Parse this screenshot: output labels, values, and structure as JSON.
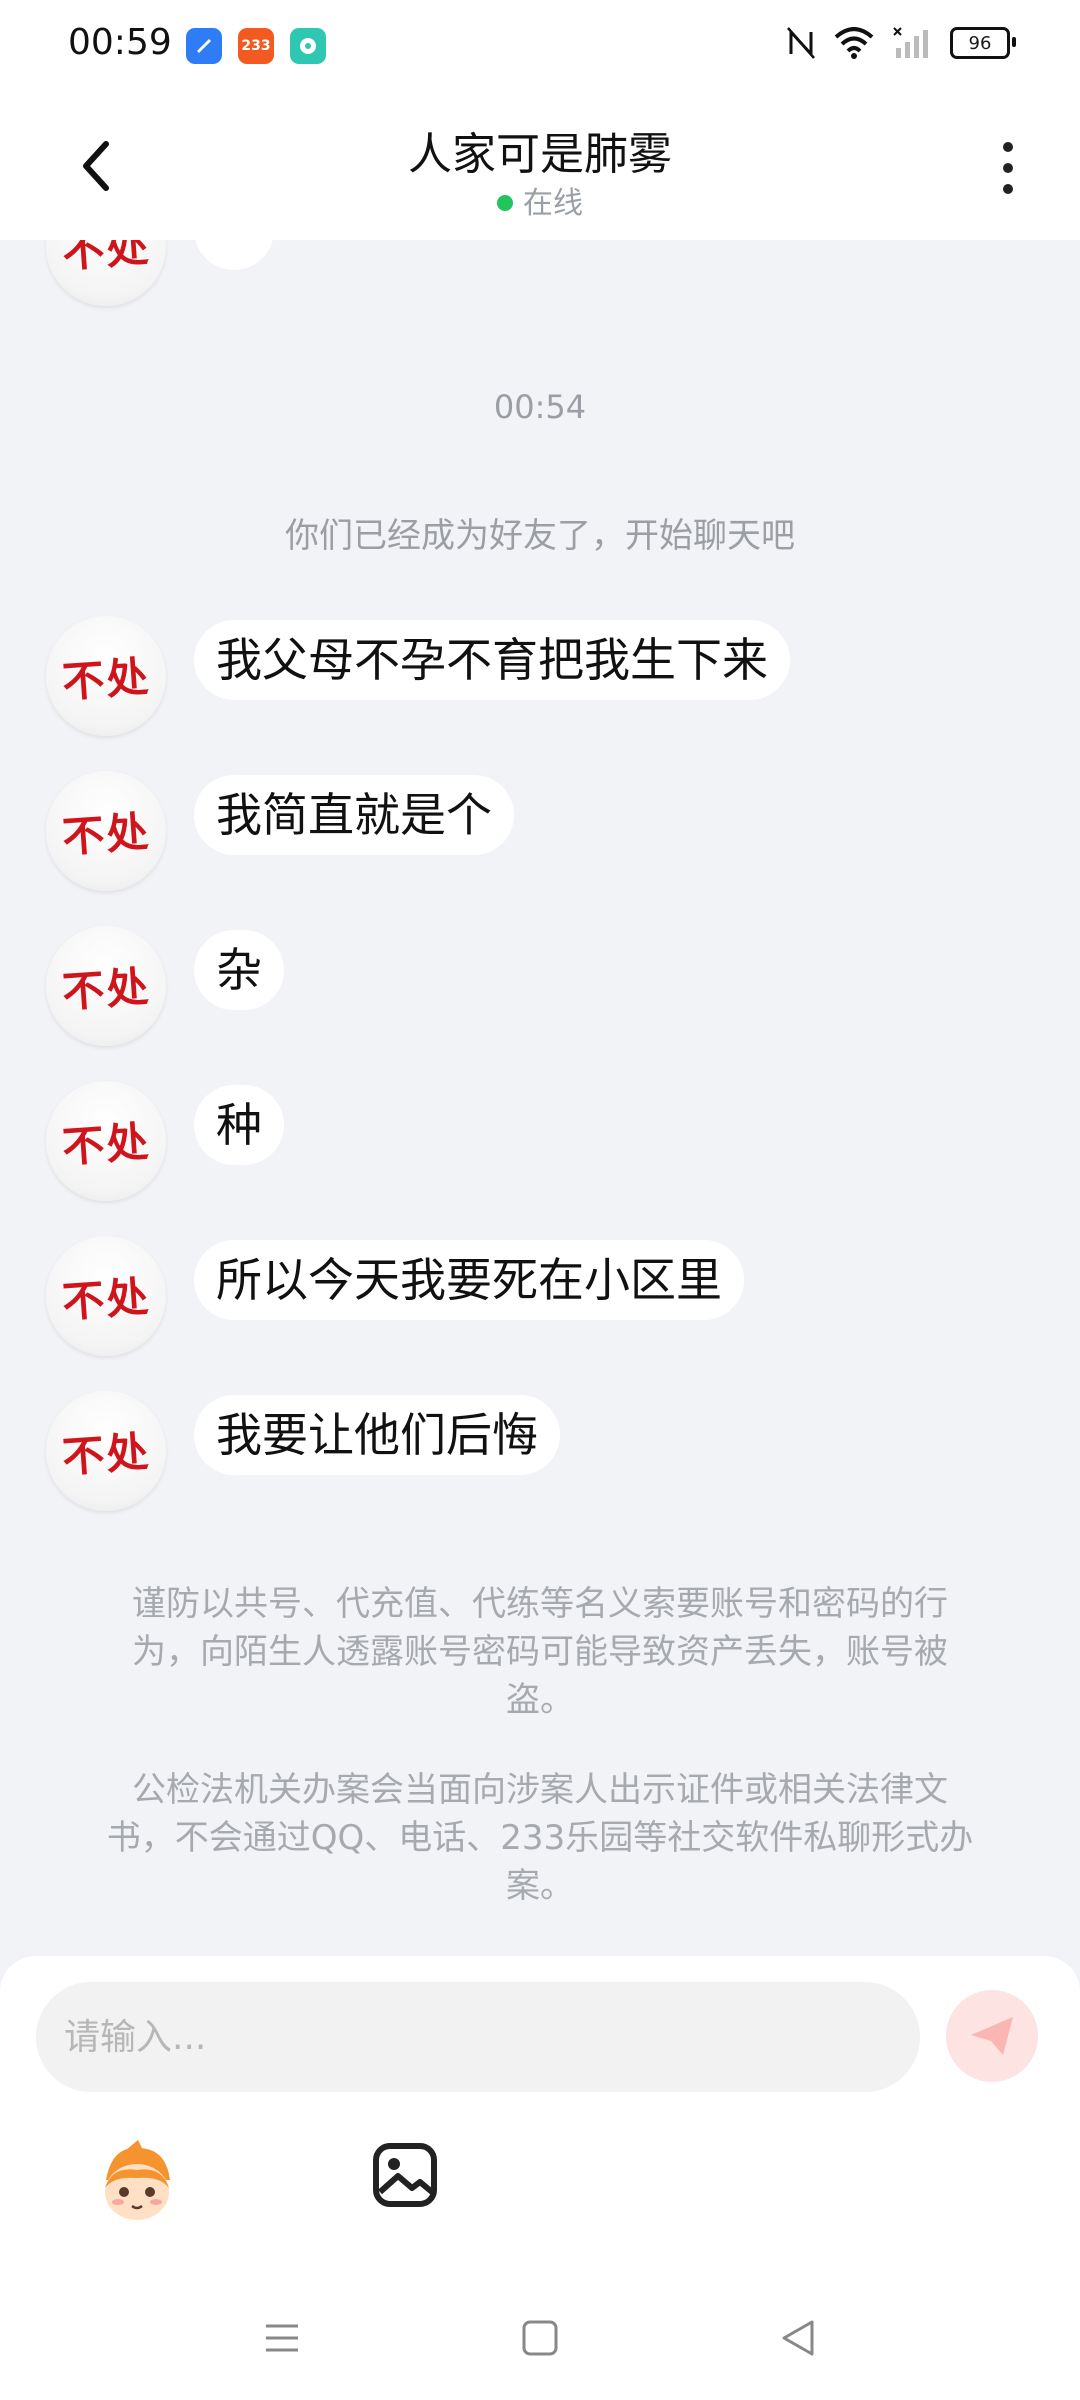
{
  "status_bar": {
    "time": "00:59",
    "app_icons": [
      {
        "name": "blue-app-icon",
        "color": "#2f7df6",
        "text": ""
      },
      {
        "name": "233-app-icon",
        "color": "#f25a22",
        "text": "233"
      },
      {
        "name": "chat-app-icon",
        "color": "#2ec7b1",
        "text": ""
      }
    ],
    "battery": "96"
  },
  "header": {
    "back_icon": "chevron-left-icon",
    "title": "人家可是肺雾",
    "presence": "在线",
    "presence_color": "#21c45d",
    "more_icon": "more-vertical-icon"
  },
  "chat": {
    "time": "00:54",
    "system_message": "你们已经成为好友了，开始聊天吧",
    "avatar_text": "不处",
    "messages": [
      {
        "text": "我父母不孕不育把我生下来"
      },
      {
        "text": "我简直就是个"
      },
      {
        "text": "杂"
      },
      {
        "text": "种"
      },
      {
        "text": "所以今天我要死在小区里"
      },
      {
        "text": "我要让他们后悔"
      }
    ],
    "notices": [
      "谨防以共号、代充值、代练等名义索要账号和密码的行为，向陌生人透露账号密码可能导致资产丢失，账号被盗。",
      "公检法机关办案会当面向涉案人出示证件或相关法律文书，不会通过QQ、电话、233乐园等社交软件私聊形式办案。"
    ]
  },
  "input": {
    "placeholder": "请输入...",
    "send_icon": "paper-plane-icon",
    "emoji_icon": "mascot-emoji-icon",
    "image_icon": "image-icon",
    "send_color": "#f7645f"
  },
  "nav": {
    "menu_icon": "menu-icon",
    "home_icon": "home-square-icon",
    "back_icon": "back-triangle-icon"
  }
}
